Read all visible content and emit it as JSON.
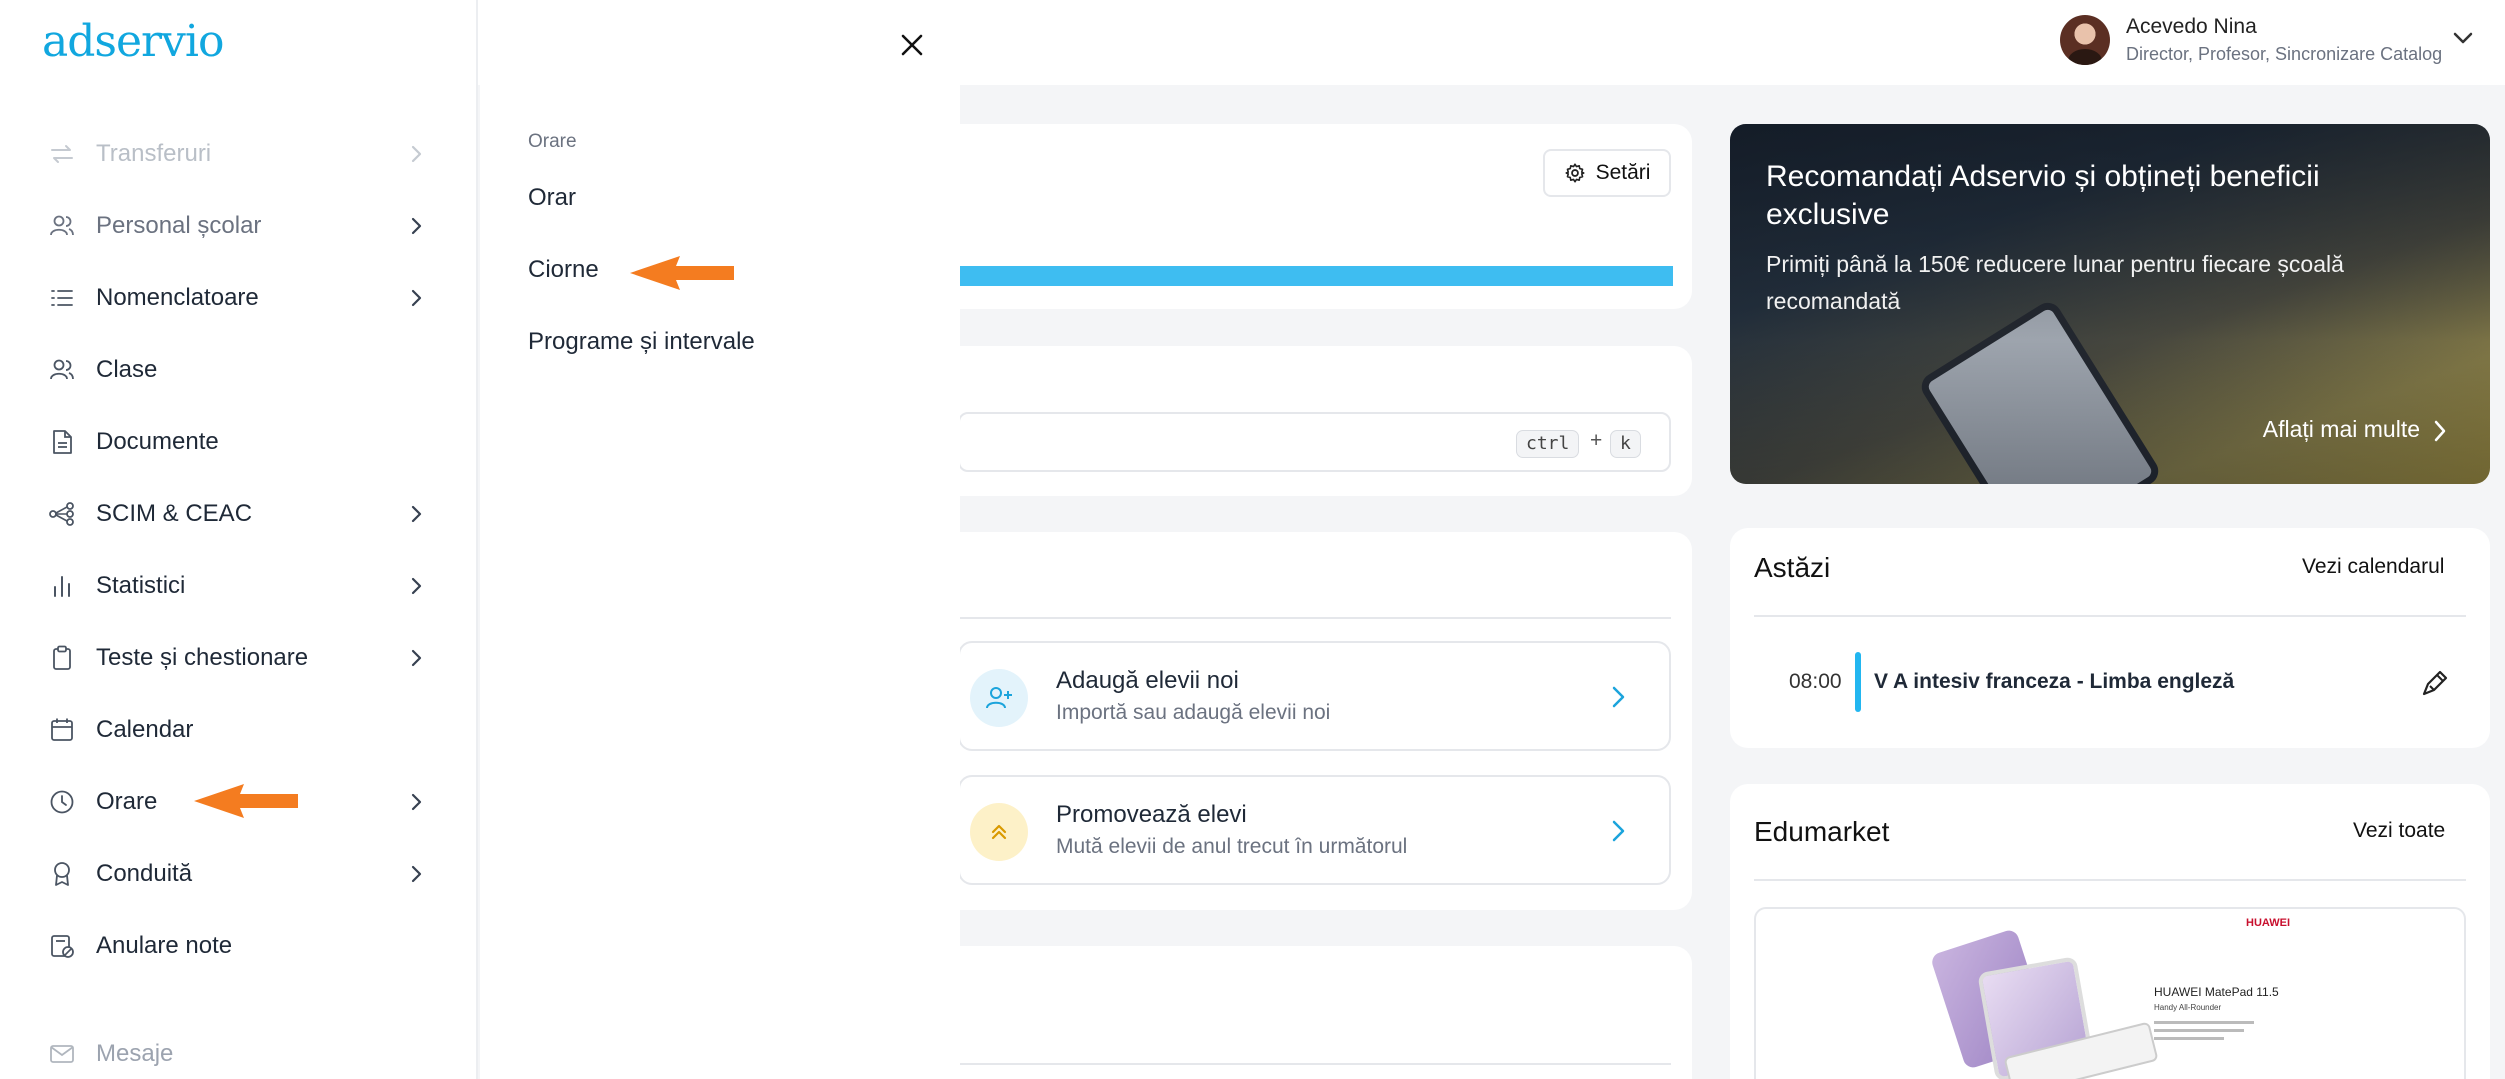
{
  "app": {
    "logo_text": "adservio",
    "brand_color": "#11a7df"
  },
  "user": {
    "name": "Acevedo Nina",
    "roles": "Director, Profesor, Sincronizare Catalog"
  },
  "sidebar": {
    "items": [
      {
        "label": "Transferuri",
        "icon": "transfer-icon",
        "state": "faded"
      },
      {
        "label": "Personal școlar",
        "icon": "users-icon",
        "state": "semi"
      },
      {
        "label": "Nomenclatoare",
        "icon": "list-icon",
        "state": "normal"
      },
      {
        "label": "Clase",
        "icon": "users-icon",
        "state": "normal"
      },
      {
        "label": "Documente",
        "icon": "document-icon",
        "state": "normal"
      },
      {
        "label": "SCIM & CEAC",
        "icon": "share-nodes-icon",
        "state": "normal"
      },
      {
        "label": "Statistici",
        "icon": "bar-chart-icon",
        "state": "normal"
      },
      {
        "label": "Teste și chestionare",
        "icon": "clipboard-icon",
        "state": "normal"
      },
      {
        "label": "Calendar",
        "icon": "calendar-icon",
        "state": "normal"
      },
      {
        "label": "Orare",
        "icon": "clock-icon",
        "state": "normal"
      },
      {
        "label": "Conduită",
        "icon": "badge-icon",
        "state": "normal"
      },
      {
        "label": "Anulare note",
        "icon": "cancel-grade-icon",
        "state": "normal"
      },
      {
        "label": "Mesaje",
        "icon": "mail-icon",
        "state": "faded"
      }
    ]
  },
  "submenu": {
    "header": "Orare",
    "items": [
      "Orar",
      "Ciorne",
      "Programe și intervale"
    ]
  },
  "dashboard": {
    "settings_label": "Setări",
    "search_kbd_ctrl": "ctrl",
    "search_kbd_plus": "+",
    "search_kbd_key": "k",
    "actions": [
      {
        "title": "Adaugă elevii noi",
        "subtitle": "Importă sau adaugă elevii noi",
        "icon": "add-user-icon"
      },
      {
        "title": "Promovează elevi",
        "subtitle": "Mută elevii de anul trecut în următorul",
        "icon": "chevrons-up-icon"
      }
    ],
    "promo": {
      "title": "Recomandați Adservio și obțineți beneficii exclusive",
      "subtitle": "Primiți până la 150€ reducere lunar pentru fiecare școală recomandată",
      "link": "Aflați mai multe"
    },
    "today": {
      "title": "Astăzi",
      "link": "Vezi calendarul",
      "event_time": "08:00",
      "event_title": "V A intesiv franceza - Limba engleză"
    },
    "edumarket": {
      "title": "Edumarket",
      "link": "Vezi toate",
      "product_brand": "HUAWEI",
      "product_name": "HUAWEI MatePad 11.5",
      "product_tag": "Handy All-Rounder"
    }
  },
  "colors": {
    "accent": "#3ebdf1",
    "annotation_arrow": "#f47c20"
  }
}
